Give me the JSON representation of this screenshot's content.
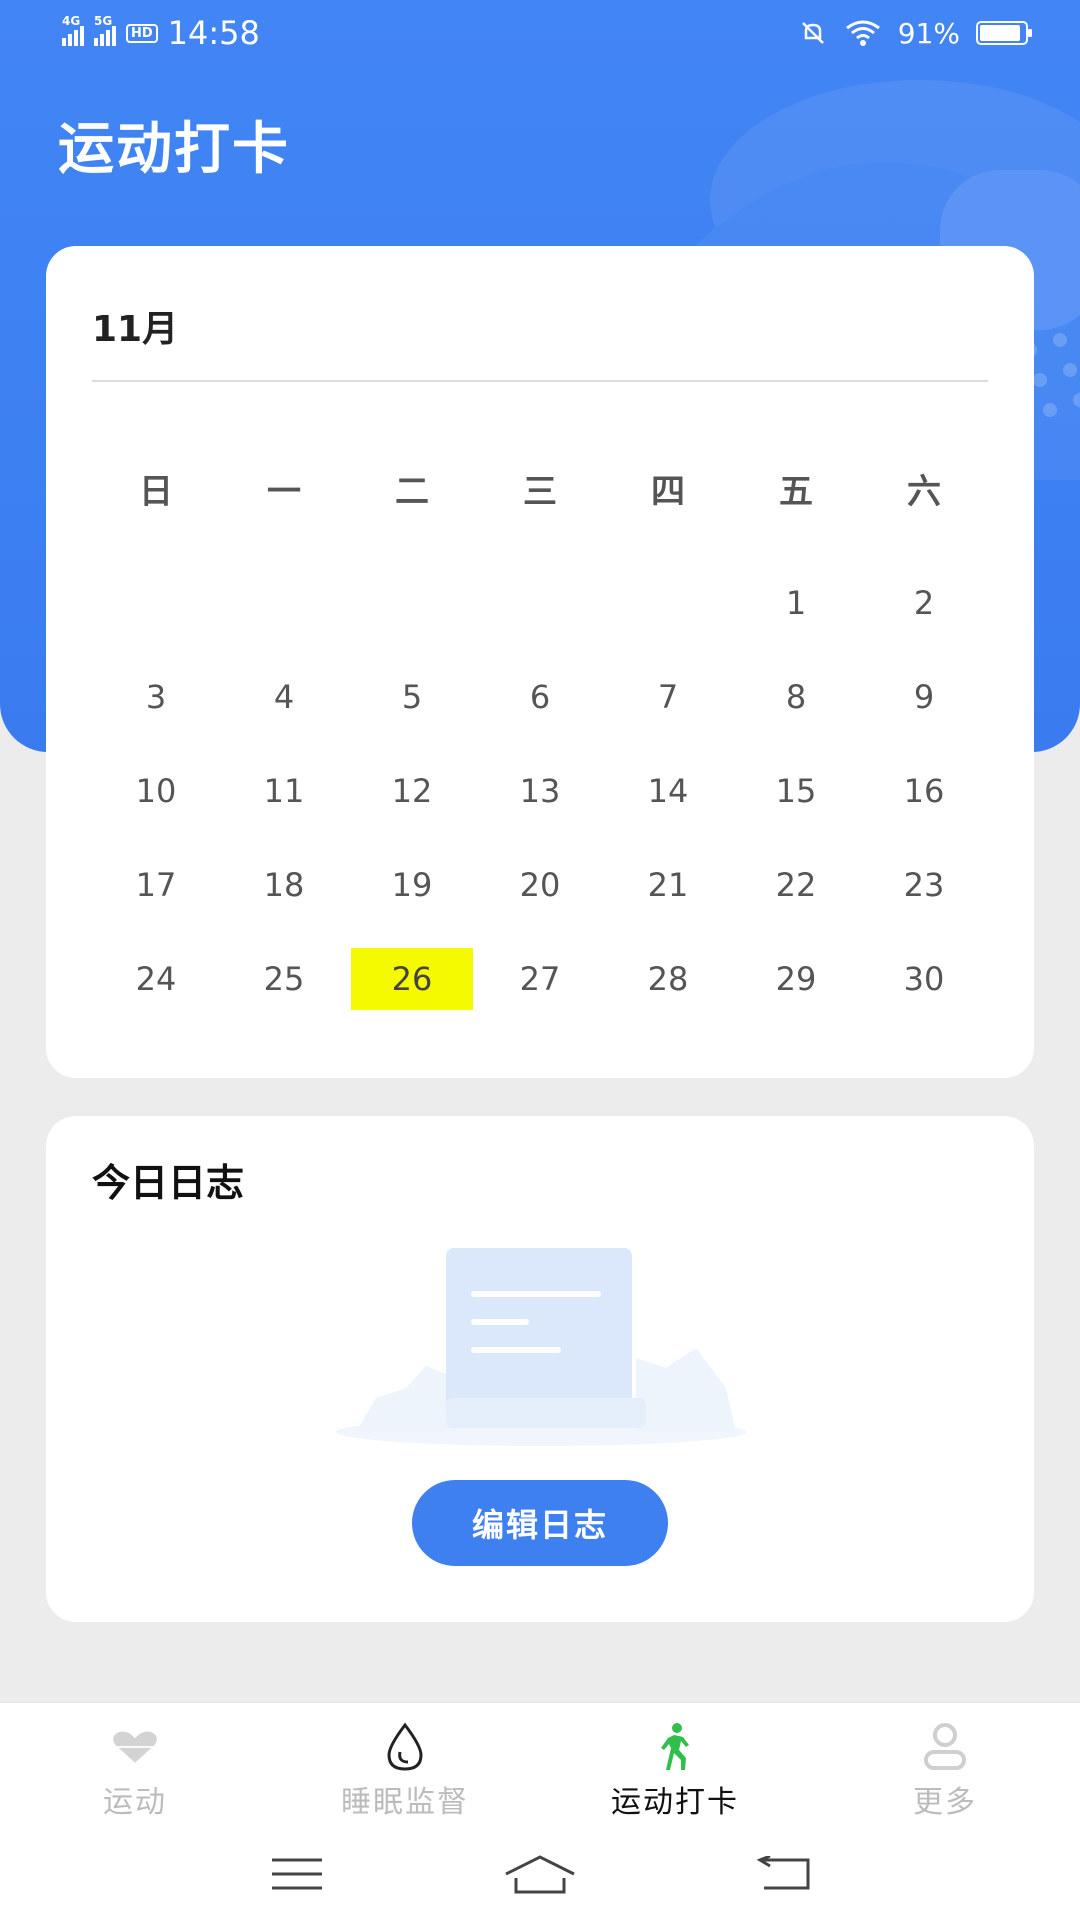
{
  "status_bar": {
    "time": "14:58",
    "signal1": "4G",
    "signal2": "5G",
    "hd": "HD",
    "battery": "91%"
  },
  "header": {
    "title": "运动打卡"
  },
  "calendar": {
    "month": "11月",
    "weekdays": [
      "日",
      "一",
      "二",
      "三",
      "四",
      "五",
      "六"
    ],
    "weeks": [
      [
        "",
        "",
        "",
        "",
        "",
        "1",
        "2"
      ],
      [
        "3",
        "4",
        "5",
        "6",
        "7",
        "8",
        "9"
      ],
      [
        "10",
        "11",
        "12",
        "13",
        "14",
        "15",
        "16"
      ],
      [
        "17",
        "18",
        "19",
        "20",
        "21",
        "22",
        "23"
      ],
      [
        "24",
        "25",
        "26",
        "27",
        "28",
        "29",
        "30"
      ]
    ],
    "selected_day": "26",
    "selected_color": "#f5fa00"
  },
  "log": {
    "title": "今日日志",
    "edit_button": "编辑日志"
  },
  "tabbar": {
    "items": [
      {
        "label": "运动",
        "icon": "heart-icon"
      },
      {
        "label": "睡眠监督",
        "icon": "water-drop-icon"
      },
      {
        "label": "运动打卡",
        "icon": "walking-person-icon",
        "active": true,
        "color": "#2fbf4a"
      },
      {
        "label": "更多",
        "icon": "person-icon"
      }
    ]
  },
  "colors": {
    "accent": "#3f80f0",
    "hero": "#4285f4"
  }
}
